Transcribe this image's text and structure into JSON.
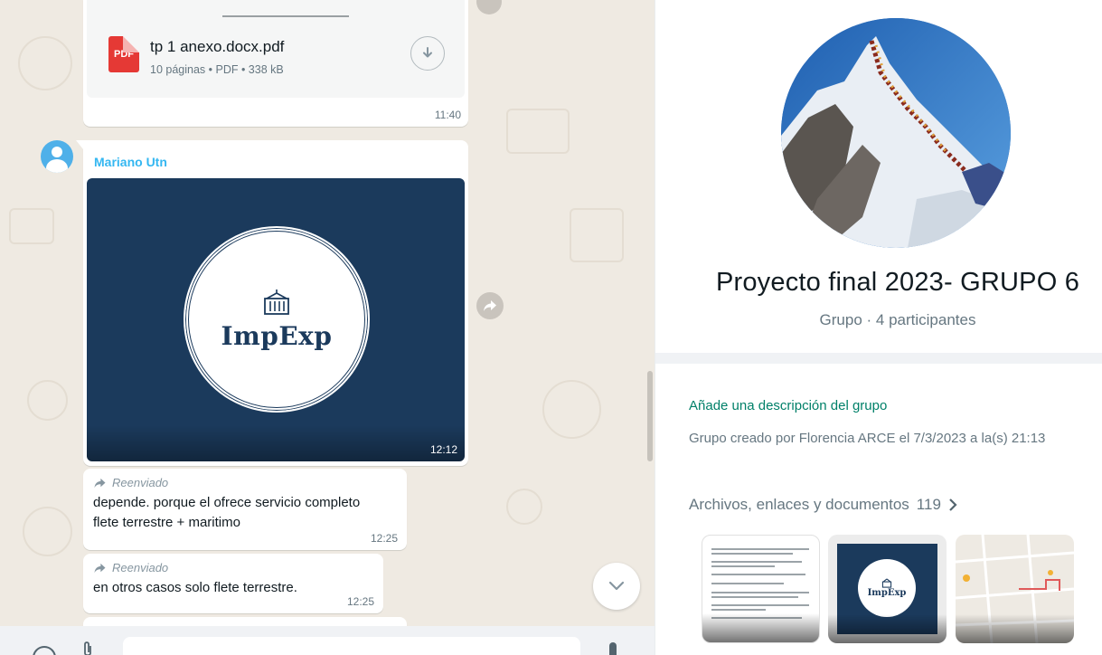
{
  "chat": {
    "doc_message": {
      "file_name": "tp 1 anexo.docx.pdf",
      "file_meta": "10 páginas • PDF • 338 kB",
      "file_type_badge": "PDF",
      "time": "11:40"
    },
    "image_message": {
      "sender": "Mariano Utn",
      "logo_text": "ImpExp",
      "time": "12:12"
    },
    "forwarded_messages": [
      {
        "label": "Reenviado",
        "text": "depende. porque el ofrece servicio completo flete terrestre + maritimo",
        "time": "12:25"
      },
      {
        "label": "Reenviado",
        "text": "en otros casos solo flete terrestre.",
        "time": "12:25"
      }
    ],
    "icons": {
      "download": "download-icon",
      "forward": "forward-icon",
      "scroll_down": "chevron-down-icon",
      "emoji": "emoji-icon",
      "attach": "attach-icon",
      "mic": "mic-icon"
    }
  },
  "group_info": {
    "title": "Proyecto final 2023- GRUPO 6",
    "subtitle": "Grupo · 4 participantes",
    "add_description": "Añade una descripción del grupo",
    "created_by": "Grupo creado por Florencia ARCE el 7/3/2023 a la(s) 21:13",
    "media_label": "Archivos, enlaces y documentos",
    "media_count": "119",
    "thumb_logo_text": "ImpExp"
  },
  "colors": {
    "chat_background": "#efeae2",
    "sender_name": "#34b7f1",
    "link_green": "#008069",
    "impexp_navy": "#1b3a5c",
    "pdf_red": "#e53935"
  }
}
